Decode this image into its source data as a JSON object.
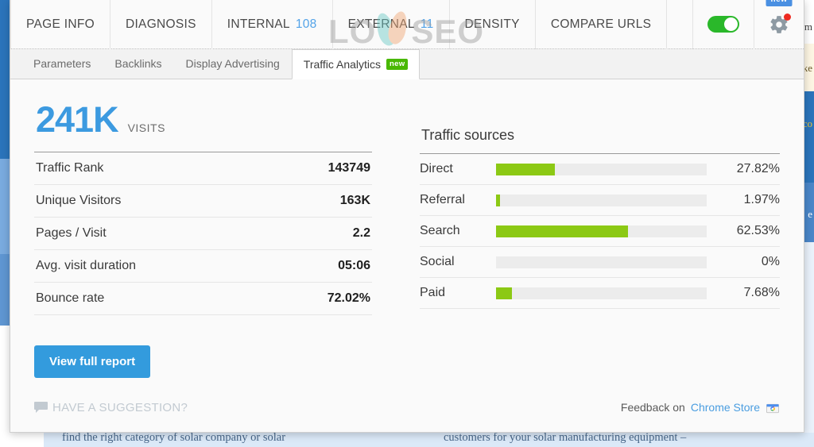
{
  "main_nav": {
    "tabs": [
      {
        "label": "PAGE INFO",
        "count": null
      },
      {
        "label": "DIAGNOSIS",
        "count": null
      },
      {
        "label": "INTERNAL",
        "count": "108"
      },
      {
        "label": "EXTERNAL",
        "count": "11"
      },
      {
        "label": "DENSITY",
        "count": null
      },
      {
        "label": "COMPARE URLS",
        "count": null
      }
    ],
    "toggle_state": "on",
    "toggle_color": "#2ab82a",
    "gear_icon": "gear-icon",
    "gear_has_alert": true,
    "alert_color": "#ee2b22",
    "new_badge": "new",
    "new_badge_color": "#4a90e2"
  },
  "watermark": {
    "text_left": "LO",
    "text_right": "SEO",
    "leaf_color_left": "#67c9c4",
    "leaf_color_right": "#f0a673"
  },
  "sub_nav": {
    "tabs": [
      {
        "label": "Parameters",
        "active": false,
        "badge": null
      },
      {
        "label": "Backlinks",
        "active": false,
        "badge": null
      },
      {
        "label": "Display Advertising",
        "active": false,
        "badge": null
      },
      {
        "label": "Traffic Analytics",
        "active": true,
        "badge": "new"
      }
    ],
    "badge_color": "#49b803"
  },
  "visits": {
    "value": "241K",
    "label": "VISITS",
    "color": "#3c9ae0"
  },
  "stats": {
    "rows": [
      {
        "label": "Traffic Rank",
        "value": "143749"
      },
      {
        "label": "Unique Visitors",
        "value": "163K"
      },
      {
        "label": "Pages / Visit",
        "value": "2.2"
      },
      {
        "label": "Avg. visit duration",
        "value": "05:06"
      },
      {
        "label": "Bounce rate",
        "value": "72.02%"
      }
    ]
  },
  "view_report_button": {
    "label": "View full report",
    "color": "#339bdd"
  },
  "traffic_sources": {
    "title": "Traffic sources",
    "bar_color": "#8cc914",
    "track_color": "#ececec",
    "pct_color": "#5b9fd8",
    "rows": [
      {
        "label": "Direct",
        "percent": "27.82%",
        "value": 27.82
      },
      {
        "label": "Referral",
        "percent": "1.97%",
        "value": 1.97
      },
      {
        "label": "Search",
        "percent": "62.53%",
        "value": 62.53
      },
      {
        "label": "Social",
        "percent": "0%",
        "value": 0
      },
      {
        "label": "Paid",
        "percent": "7.68%",
        "value": 7.68
      }
    ]
  },
  "footer": {
    "suggestion_label": "HAVE A SUGGESTION?",
    "suggestion_icon": "speech-bubble-icon",
    "feedback_prefix": "Feedback on",
    "feedback_link": "Chrome Store",
    "feedback_icon": "chrome-web-store-icon"
  },
  "background_page": {
    "text_left": "find the right category of solar company or solar",
    "text_right": "customers for your solar manufacturing equipment –"
  }
}
